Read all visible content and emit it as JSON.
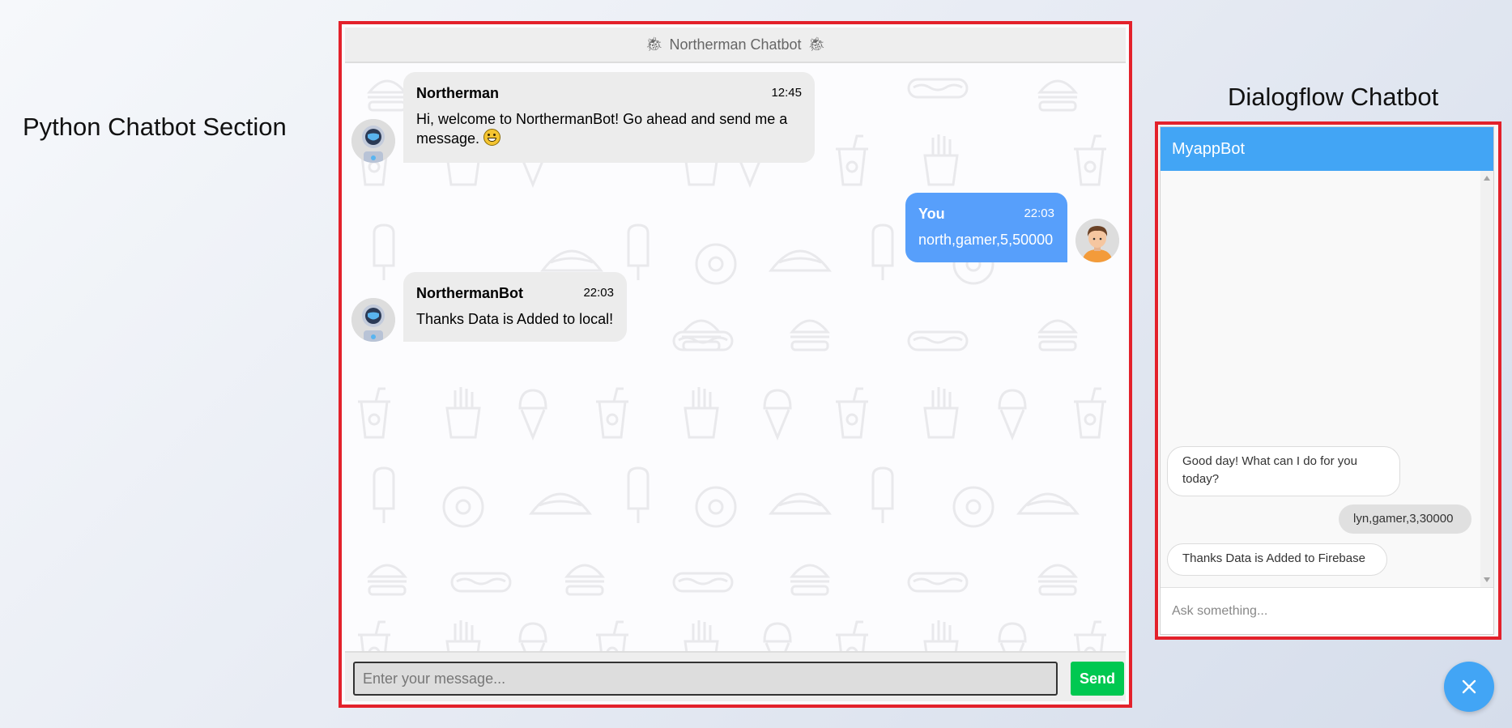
{
  "labels": {
    "python_section": "Python Chatbot Section",
    "dialogflow_section": "Dialogflow Chatbot"
  },
  "python_chat": {
    "header_icon": "bug-icon",
    "title": "Northerman Chatbot",
    "messages": [
      {
        "sender": "Northerman",
        "time": "12:45",
        "text": "Hi, welcome to NorthermanBot! Go ahead and send me a message.",
        "side": "left",
        "avatar": "robot-avatar"
      },
      {
        "sender": "You",
        "time": "22:03",
        "text": "north,gamer,5,50000",
        "side": "right",
        "avatar": "user-avatar"
      },
      {
        "sender": "NorthermanBot",
        "time": "22:03",
        "text": "Thanks Data is Added to local!",
        "side": "left",
        "avatar": "robot-avatar"
      }
    ],
    "input_placeholder": "Enter your message...",
    "send_label": "Send"
  },
  "dialogflow_chat": {
    "title": "MyappBot",
    "messages": [
      {
        "from": "bot",
        "text": "Good day! What can I do for you today?"
      },
      {
        "from": "user",
        "text": "lyn,gamer,3,30000"
      },
      {
        "from": "bot",
        "text": "Thanks Data is Added to Firebase"
      }
    ],
    "input_placeholder": "Ask something...",
    "toggle_icon": "close-icon"
  },
  "colors": {
    "outline": "#e3212b",
    "user_bubble": "#579ffb",
    "bot_bubble": "#ececec",
    "send_button": "#00c851",
    "df_header": "#42a5f5"
  }
}
